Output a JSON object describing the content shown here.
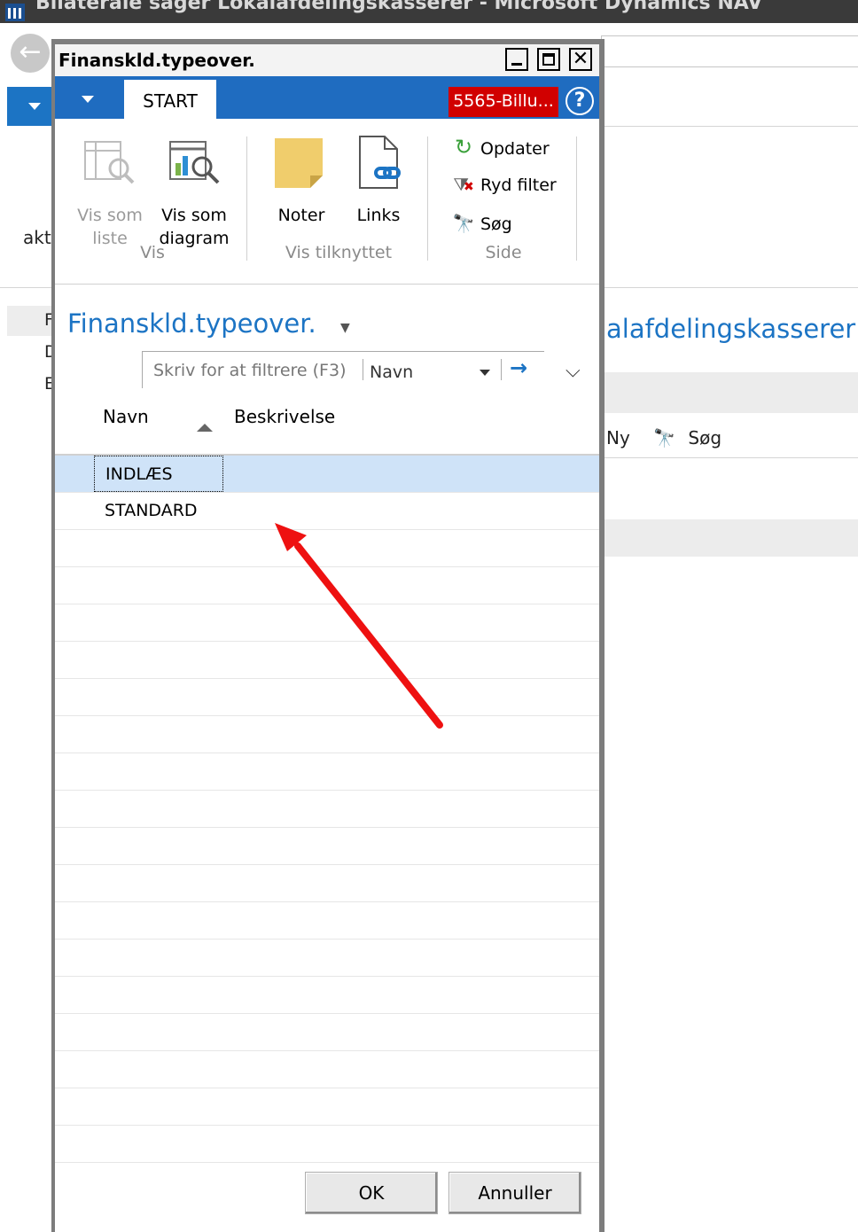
{
  "background": {
    "window_title": "Bilaterale sager Lokalafdelingskasserer - Microsoft Dynamics NAV",
    "left_label": "akt",
    "nav_letters": [
      "F",
      "D",
      "E"
    ],
    "page_title": "Lokalafdelingskasserer",
    "page_title_visible": "alafdelingskasserer",
    "actions": {
      "new_label": "Ny",
      "search_label": "Søg"
    }
  },
  "dialog": {
    "title": "Finanskld.typeover.",
    "tab_label": "START",
    "company_badge": "5565-Billu...",
    "help_label": "?",
    "ribbon": {
      "vis_group_label": "Vis",
      "vis_som_liste_line1": "Vis som",
      "vis_som_liste_line2": "liste",
      "vis_som_diagram_line1": "Vis som",
      "vis_som_diagram_line2": "diagram",
      "tilknyttet_group_label": "Vis tilknyttet",
      "noter_label": "Noter",
      "links_label": "Links",
      "side_group_label": "Side",
      "opdater_label": "Opdater",
      "ryd_filter_label": "Ryd filter",
      "soeg_label": "Søg"
    },
    "page_heading": "Finanskld.typeover.",
    "filter": {
      "placeholder": "Skriv for at filtrere (F3)",
      "field": "Navn"
    },
    "columns": {
      "name": "Navn",
      "description": "Beskrivelse"
    },
    "rows": [
      {
        "name": "INDLÆS",
        "description": "",
        "selected": true
      },
      {
        "name": "STANDARD",
        "description": "",
        "selected": false
      }
    ],
    "buttons": {
      "ok": "OK",
      "cancel": "Annuller"
    }
  },
  "colors": {
    "accent_blue": "#1f6cc0",
    "link_blue": "#1c74c4",
    "company_red": "#d10000",
    "selected_row": "#cfe3f8",
    "annotation_arrow": "#ee1111"
  }
}
